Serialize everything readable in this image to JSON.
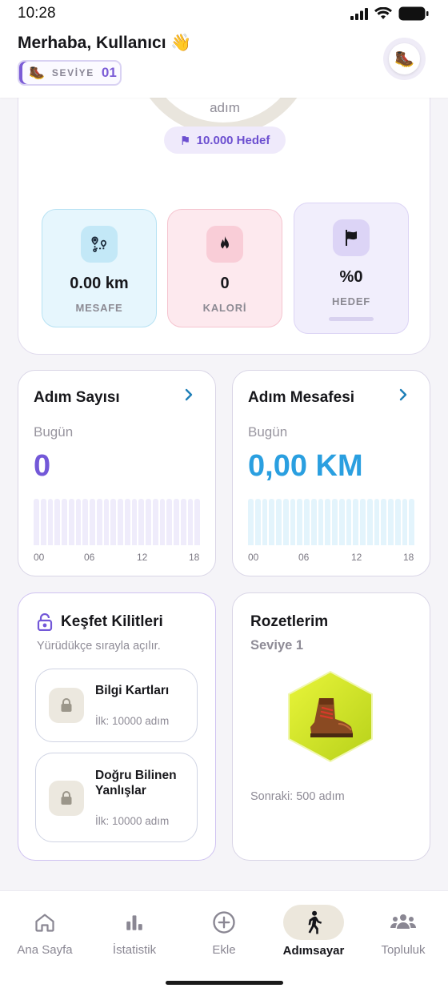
{
  "status_bar": {
    "time": "10:28"
  },
  "header": {
    "greeting": "Merhaba, Kullanıcı 👋",
    "level_label": "SEVİYE",
    "level_value": "01",
    "level_icon": "boot-icon",
    "avatar_icon": "boot-icon"
  },
  "summary": {
    "unit_label": "adım",
    "goal_chip": "10.000 Hedef",
    "stats": [
      {
        "value": "0.00 km",
        "caption": "MESAFE",
        "icon": "route-pin-icon"
      },
      {
        "value": "0",
        "caption": "KALORİ",
        "icon": "flame-icon"
      },
      {
        "value": "%0",
        "caption": "HEDEF",
        "icon": "flag-icon",
        "progress": 0
      }
    ]
  },
  "steps_card": {
    "title": "Adım Sayısı",
    "subtitle": "Bugün",
    "value": "0",
    "ticks": [
      "00",
      "06",
      "12",
      "18"
    ],
    "color": "#7358d8"
  },
  "distance_card": {
    "title": "Adım Mesafesi",
    "subtitle": "Bugün",
    "value": "0,00 KM",
    "ticks": [
      "00",
      "06",
      "12",
      "18"
    ],
    "color": "#2a9fe0"
  },
  "unlock_card": {
    "title": "Keşfet Kilitleri",
    "subtitle": "Yürüdükçe sırayla açılır.",
    "items": [
      {
        "name": "Bilgi Kartları",
        "requirement": "İlk: 10000 adım"
      },
      {
        "name": "Doğru Bilinen Yanlışlar",
        "requirement": "İlk: 10000 adım"
      }
    ]
  },
  "badges_card": {
    "title": "Rozetlerim",
    "level": "Seviye 1",
    "next": "Sonraki: 500 adım",
    "badge_icon": "boot-icon"
  },
  "nav": {
    "items": [
      {
        "label": "Ana Sayfa",
        "icon": "home-icon"
      },
      {
        "label": "İstatistik",
        "icon": "bar-chart-icon"
      },
      {
        "label": "Ekle",
        "icon": "plus-circle-icon"
      },
      {
        "label": "Adımsayar",
        "icon": "walking-icon",
        "active": true
      },
      {
        "label": "Topluluk",
        "icon": "people-icon"
      }
    ]
  },
  "colors": {
    "accent_purple": "#7358d8",
    "accent_blue": "#2a9fe0"
  }
}
